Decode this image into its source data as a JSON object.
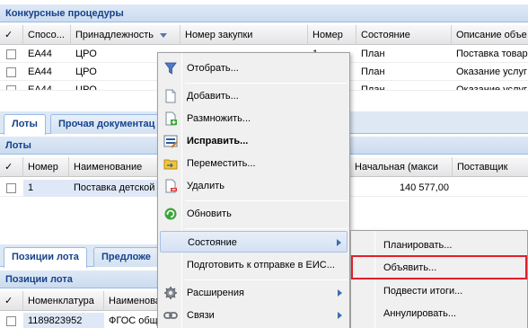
{
  "top_panel": {
    "title": "Конкурсные процедуры",
    "columns": [
      "✓",
      "Спосо...",
      "Принадлежность",
      "Номер закупки",
      "Номер",
      "Состояние",
      "Описание объе"
    ],
    "rows": [
      {
        "method": "ЕА44",
        "affiliation": "ЦРО",
        "purchase_no": "",
        "number": "1",
        "state": "План",
        "description": "Поставка товар"
      },
      {
        "method": "ЕА44",
        "affiliation": "ЦРО",
        "purchase_no": "",
        "number": "",
        "state": "План",
        "description": "Оказание услуг"
      },
      {
        "method": "ЕА44",
        "affiliation": "ЦРО",
        "purchase_no": "",
        "number": "",
        "state": "План",
        "description": "Оказание услуг"
      }
    ]
  },
  "tabs1": [
    "Лоты",
    "Прочая документац"
  ],
  "lots_panel": {
    "title": "Лоты",
    "columns": [
      "✓",
      "Номер",
      "Наименование",
      "Начальная (макси",
      "Поставщик"
    ],
    "rows": [
      {
        "number": "1",
        "name": "Поставка детской",
        "price": "140 577,00",
        "supplier": ""
      }
    ]
  },
  "tabs2": [
    "Позиции лота",
    "Предложе"
  ],
  "positions_panel": {
    "title": "Позиции лота",
    "columns": [
      "✓",
      "Номенклатура",
      "Наименова"
    ],
    "rows": [
      {
        "nomenclature": "1189823952",
        "name": "ФГОС общ"
      }
    ]
  },
  "context_menu": {
    "items": [
      {
        "label": "Отобрать...",
        "icon": "filter-icon"
      },
      {
        "label": "Добавить...",
        "icon": "new-document-icon"
      },
      {
        "label": "Размножить...",
        "icon": "copy-document-icon"
      },
      {
        "label": "Исправить...",
        "icon": "edit-icon"
      },
      {
        "label": "Переместить...",
        "icon": "folder-move-icon"
      },
      {
        "label": "Удалить",
        "icon": "delete-document-icon"
      },
      {
        "label": "Обновить",
        "icon": "refresh-icon"
      },
      {
        "label": "Состояние",
        "icon": ""
      },
      {
        "label": "Подготовить к отправке в ЕИС...",
        "icon": ""
      },
      {
        "label": "Расширения",
        "icon": "gear-icon"
      },
      {
        "label": "Связи",
        "icon": "link-icon"
      }
    ]
  },
  "submenu": {
    "items": [
      "Планировать...",
      "Объявить...",
      "Подвести итоги...",
      "Аннулировать..."
    ]
  }
}
